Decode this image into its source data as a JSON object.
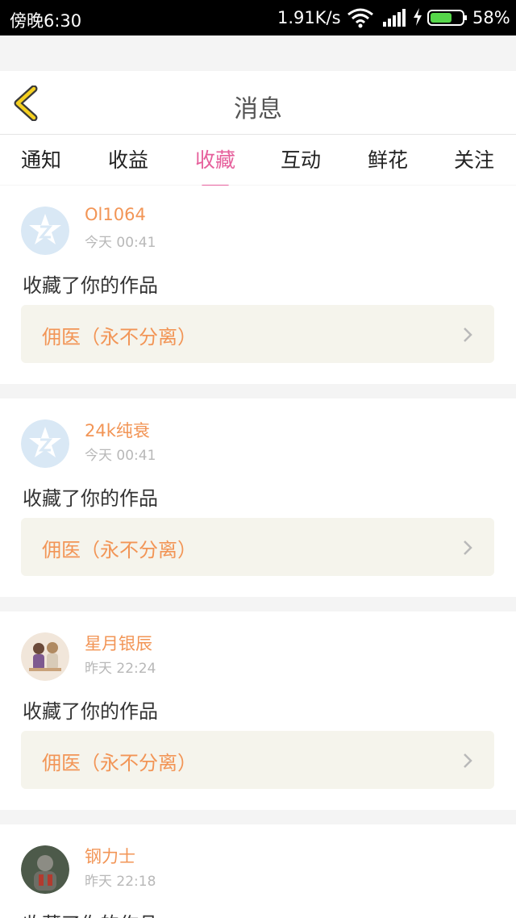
{
  "status_bar": {
    "time": "傍晚6:30",
    "speed": "1.91K/s",
    "battery": "58%",
    "icons": [
      "wifi-icon",
      "signal-icon",
      "charging-icon",
      "battery-icon"
    ]
  },
  "header": {
    "back_icon": "chevron-left-icon",
    "title": "消息"
  },
  "tabs": [
    {
      "label": "通知"
    },
    {
      "label": "收益"
    },
    {
      "label": "收藏",
      "active": true
    },
    {
      "label": "互动"
    },
    {
      "label": "鲜花"
    },
    {
      "label": "关注"
    }
  ],
  "messages": [
    {
      "username": "Ol1064",
      "time": "今天 00:41",
      "action": "收藏了你的作品",
      "work_title": "佣医（永不分离）",
      "avatar": "qzone-default-avatar"
    },
    {
      "username": "24k纯衰",
      "time": "今天 00:41",
      "action": "收藏了你的作品",
      "work_title": "佣医（永不分离）",
      "avatar": "qzone-default-avatar"
    },
    {
      "username": "星月银辰",
      "time": "昨天 22:24",
      "action": "收藏了你的作品",
      "work_title": "佣医（永不分离）",
      "avatar": "illustration-avatar"
    },
    {
      "username": "钢力士",
      "time": "昨天 22:18",
      "action": "收藏了你的作品",
      "work_title": "",
      "avatar": "photo-avatar"
    }
  ],
  "colors": {
    "accent": "#e6609c",
    "username": "#f29556",
    "back_icon": "#f5d020"
  }
}
